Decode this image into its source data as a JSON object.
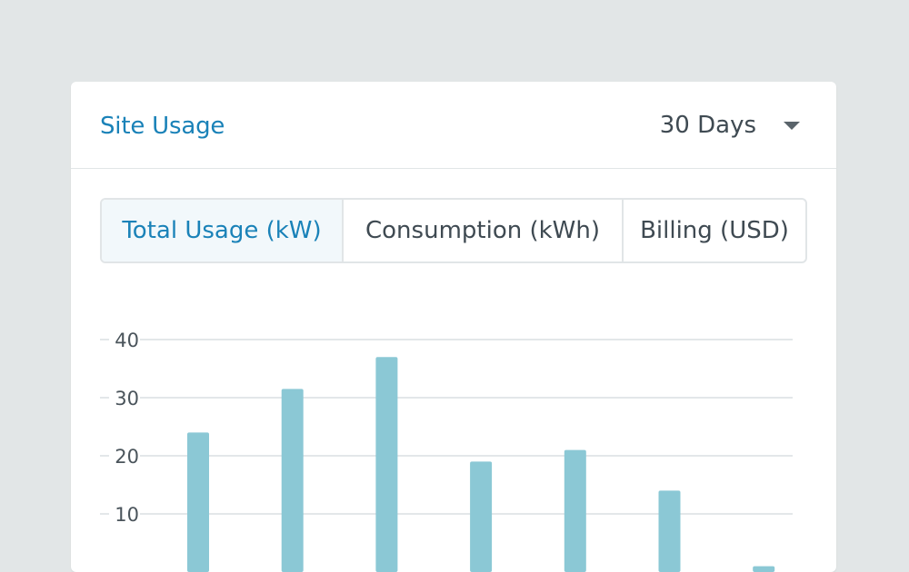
{
  "card": {
    "title": "Site Usage",
    "range": {
      "selected": "30 Days"
    }
  },
  "tabs": [
    {
      "label": "Total Usage (kW)",
      "active": true
    },
    {
      "label": "Consumption (kWh)",
      "active": false
    },
    {
      "label": "Billing (USD)",
      "active": false
    }
  ],
  "colors": {
    "accent": "#1a82b8",
    "bar": "#8bc8d5",
    "grid": "#e3e7e9"
  },
  "chart_data": {
    "type": "bar",
    "categories": [
      "",
      "",
      "",
      "",
      "",
      "",
      ""
    ],
    "values": [
      24,
      31.5,
      37,
      19,
      21,
      14,
      1
    ],
    "ylim": [
      0,
      40
    ],
    "yticks": [
      10,
      20,
      30,
      40
    ],
    "title": "",
    "xlabel": "",
    "ylabel": "",
    "grid": true
  }
}
